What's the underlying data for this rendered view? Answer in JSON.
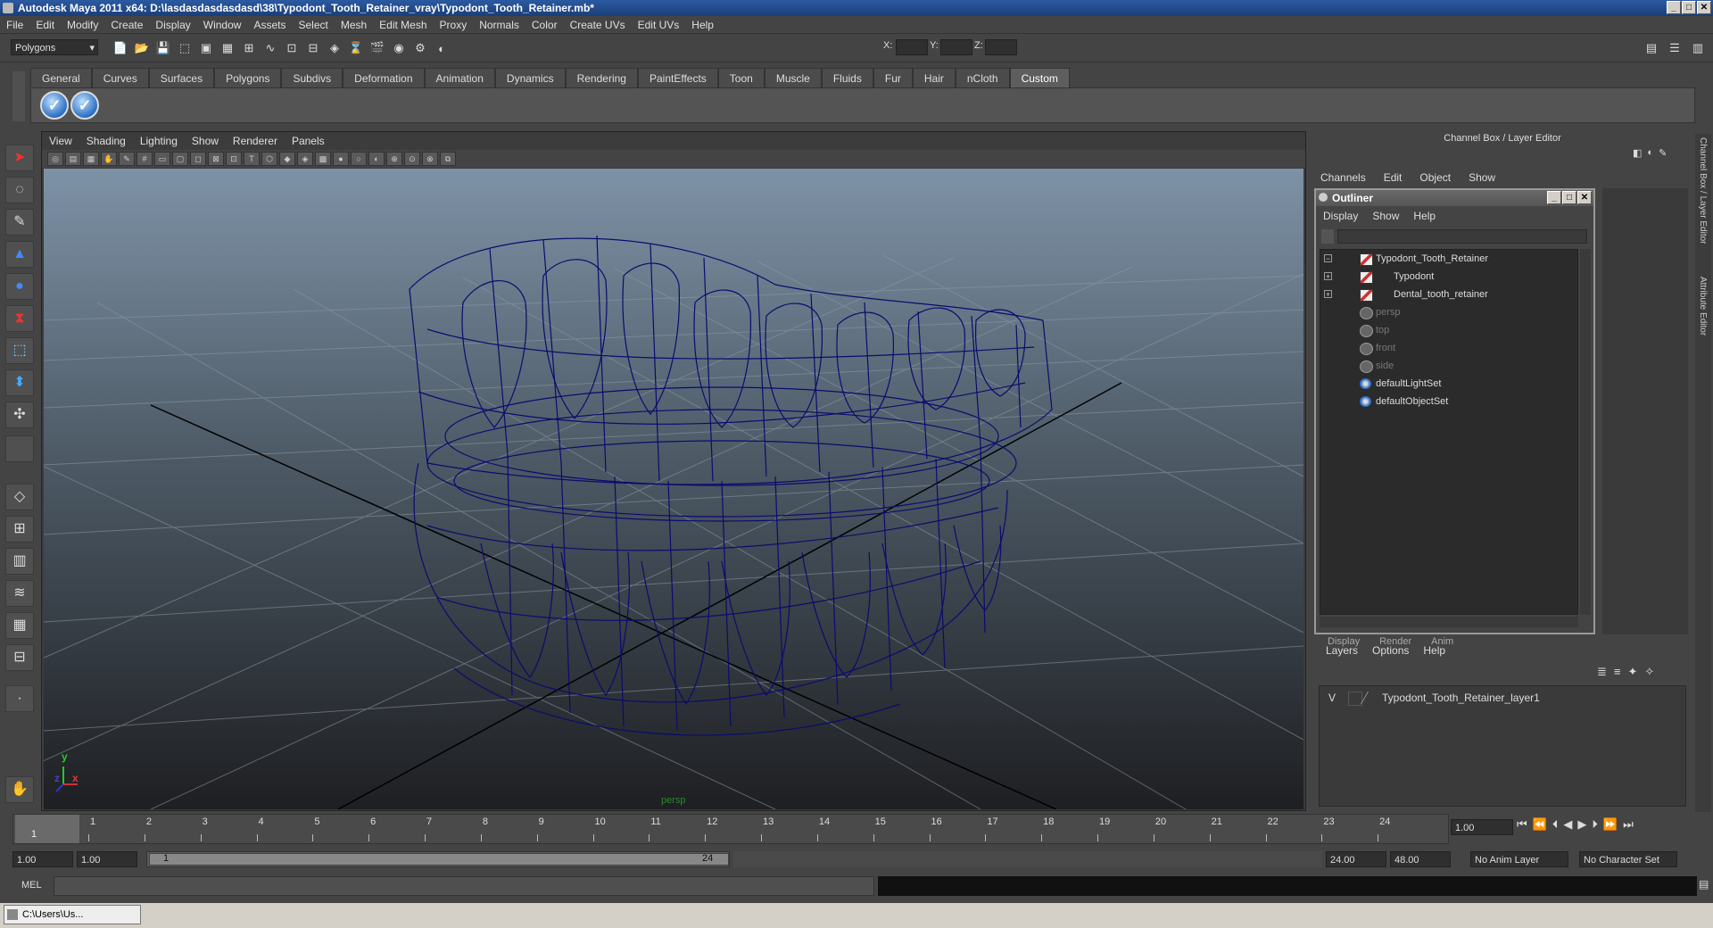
{
  "window": {
    "title": "Autodesk Maya 2011 x64: D:\\lasdasdasdasdasd\\38\\Typodont_Tooth_Retainer_vray\\Typodont_Tooth_Retainer.mb*",
    "minimize_glyph": "_",
    "maximize_glyph": "□",
    "close_glyph": "✕"
  },
  "menubar": [
    "File",
    "Edit",
    "Modify",
    "Create",
    "Display",
    "Window",
    "Assets",
    "Select",
    "Mesh",
    "Edit Mesh",
    "Proxy",
    "Normals",
    "Color",
    "Create UVs",
    "Edit UVs",
    "Help"
  ],
  "statusline": {
    "mode": "Polygons",
    "x_label": "X:",
    "y_label": "Y:",
    "z_label": "Z:"
  },
  "shelf": {
    "tabs": [
      "General",
      "Curves",
      "Surfaces",
      "Polygons",
      "Subdivs",
      "Deformation",
      "Animation",
      "Dynamics",
      "Rendering",
      "PaintEffects",
      "Toon",
      "Muscle",
      "Fluids",
      "Fur",
      "Hair",
      "nCloth",
      "Custom"
    ],
    "active_tab": "Custom",
    "button_glyph": "✓"
  },
  "viewport": {
    "menu": [
      "View",
      "Shading",
      "Lighting",
      "Show",
      "Renderer",
      "Panels"
    ],
    "camera_label": "persp",
    "axis_y": "y",
    "axis_x": "x",
    "axis_z": "z",
    "wire_color": "#0b0b6e"
  },
  "channel_box": {
    "title": "Channel Box / Layer Editor",
    "menu": [
      "Channels",
      "Edit",
      "Object",
      "Show"
    ]
  },
  "outliner": {
    "title": "Outliner",
    "menu": [
      "Display",
      "Show",
      "Help"
    ],
    "items": [
      {
        "label": "Typodont_Tooth_Retainer",
        "expand": "−",
        "type": "mesh",
        "indent": 0,
        "dim": false
      },
      {
        "label": "Typodont",
        "expand": "+",
        "type": "mesh",
        "indent": 1,
        "dim": false
      },
      {
        "label": "Dental_tooth_retainer",
        "expand": "+",
        "type": "mesh",
        "indent": 1,
        "dim": false
      },
      {
        "label": "persp",
        "expand": "",
        "type": "camera",
        "indent": 0,
        "dim": true
      },
      {
        "label": "top",
        "expand": "",
        "type": "camera",
        "indent": 0,
        "dim": true
      },
      {
        "label": "front",
        "expand": "",
        "type": "camera",
        "indent": 0,
        "dim": true
      },
      {
        "label": "side",
        "expand": "",
        "type": "camera",
        "indent": 0,
        "dim": true
      },
      {
        "label": "defaultLightSet",
        "expand": "",
        "type": "set",
        "indent": 0,
        "dim": false
      },
      {
        "label": "defaultObjectSet",
        "expand": "",
        "type": "set",
        "indent": 0,
        "dim": false
      }
    ]
  },
  "layer_editor": {
    "tabs": [
      "Display",
      "Render",
      "Anim"
    ],
    "menu": [
      "Layers",
      "Options",
      "Help"
    ],
    "layer_visibility": "V",
    "layer_name": "Typodont_Tooth_Retainer_layer1"
  },
  "time": {
    "ticks": [
      "1",
      "2",
      "3",
      "4",
      "5",
      "6",
      "7",
      "8",
      "9",
      "10",
      "11",
      "12",
      "13",
      "14",
      "15",
      "16",
      "17",
      "18",
      "19",
      "20",
      "21",
      "22",
      "23",
      "24"
    ],
    "current_frame": "1",
    "current_time_field": "1.00",
    "range_start": "1.00",
    "playback_start": "1.00",
    "range_slider_start": "1",
    "range_slider_end": "24",
    "playback_end": "24.00",
    "range_end": "48.00",
    "anim_layer": "No Anim Layer",
    "character_set": "No Character Set"
  },
  "commandline": {
    "label": "MEL"
  },
  "side_tabs": [
    "Channel Box / Layer Editor",
    "Attribute Editor"
  ],
  "taskbar": {
    "item": "C:\\Users\\Us..."
  }
}
